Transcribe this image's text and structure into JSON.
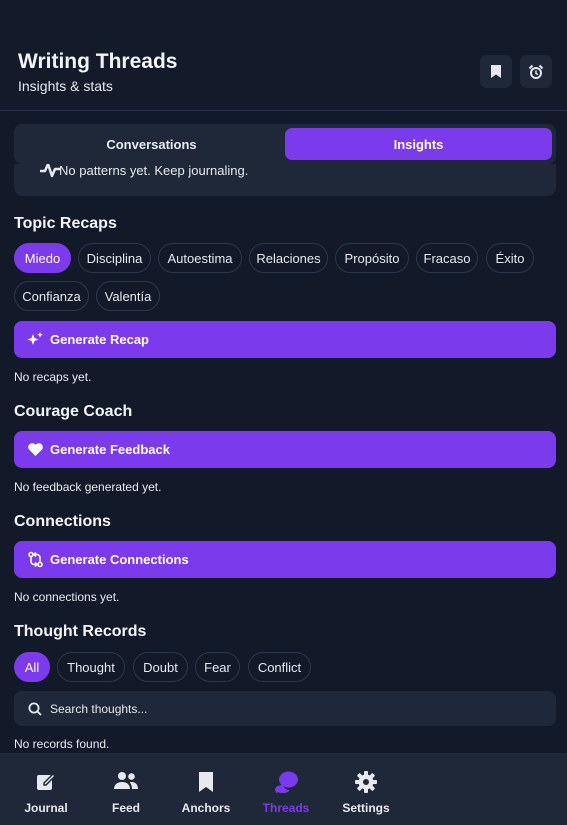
{
  "header": {
    "title": "Writing Threads",
    "subtitle": "Insights & stats"
  },
  "tabs": [
    {
      "label": "Conversations",
      "active": false
    },
    {
      "label": "Insights",
      "active": true
    }
  ],
  "patterns": {
    "text": "No patterns yet. Keep journaling."
  },
  "topic_recaps": {
    "title": "Topic Recaps",
    "chips": [
      "Miedo",
      "Disciplina",
      "Autoestima",
      "Relaciones",
      "Propósito",
      "Fracaso",
      "Éxito",
      "Confianza",
      "Valentía"
    ],
    "selected": "Miedo",
    "button": "Generate Recap",
    "empty": "No recaps yet."
  },
  "courage_coach": {
    "title": "Courage Coach",
    "button": "Generate Feedback",
    "empty": "No feedback generated yet."
  },
  "connections": {
    "title": "Connections",
    "button": "Generate Connections",
    "empty": "No connections yet."
  },
  "thought_records": {
    "title": "Thought Records",
    "filters": [
      "All",
      "Thought",
      "Doubt",
      "Fear",
      "Conflict"
    ],
    "selected": "All",
    "search_placeholder": "Search thoughts...",
    "empty": "No records found."
  },
  "nav": [
    {
      "label": "Journal",
      "icon": "edit-icon"
    },
    {
      "label": "Feed",
      "icon": "users-icon"
    },
    {
      "label": "Anchors",
      "icon": "bookmark-icon"
    },
    {
      "label": "Threads",
      "icon": "chat-bubbles-icon",
      "active": true
    },
    {
      "label": "Settings",
      "icon": "gear-icon"
    }
  ],
  "colors": {
    "accent": "#7c3aed",
    "background": "#121a2a",
    "surface": "#1f2838"
  }
}
